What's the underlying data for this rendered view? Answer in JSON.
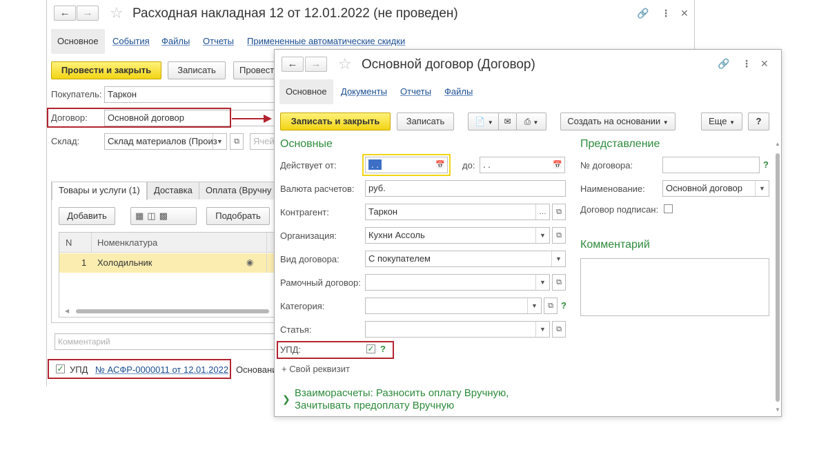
{
  "back": {
    "title": "Расходная накладная 12 от 12.01.2022 (не проведен)",
    "tabs": [
      "Основное",
      "События",
      "Файлы",
      "Отчеты",
      "Примененные автоматические скидки"
    ],
    "toolbar": {
      "post_close": "Провести и закрыть",
      "save": "Записать",
      "post": "Провест"
    },
    "buyer_label": "Покупатель:",
    "buyer_value": "Таркон",
    "contract_label": "Договор:",
    "contract_value": "Основной договор",
    "warehouse_label": "Склад:",
    "warehouse_value": "Склад материалов (Произ",
    "cell_placeholder": "Ячей",
    "inner_tabs": [
      "Товары и услуги (1)",
      "Доставка",
      "Оплата (Вручну"
    ],
    "table_toolbar": {
      "add": "Добавить",
      "pick": "Подобрать"
    },
    "table": {
      "headers": [
        "N",
        "Номенклатура"
      ],
      "rows": [
        {
          "n": "1",
          "item": "Холодильник"
        }
      ]
    },
    "comment_placeholder": "Комментарий",
    "upd_label": "УПД",
    "upd_link": "№ АСФР-0000011 от 12.01.2022",
    "basis_text": "Основани"
  },
  "front": {
    "title": "Основной договор (Договор)",
    "tabs": [
      "Основное",
      "Документы",
      "Отчеты",
      "Файлы"
    ],
    "toolbar": {
      "save_close": "Записать и закрыть",
      "save": "Записать",
      "create_basis": "Создать на основании",
      "more": "Еще",
      "help": "?"
    },
    "section_main": "Основные",
    "valid_from_label": "Действует от:",
    "valid_from_value": " .  .",
    "valid_to_label": "до:",
    "valid_to_value": " .  .",
    "currency_label": "Валюта расчетов:",
    "currency_value": "руб.",
    "counterparty_label": "Контрагент:",
    "counterparty_value": "Таркон",
    "organization_label": "Организация:",
    "organization_value": "Кухни Ассоль",
    "contract_type_label": "Вид договора:",
    "contract_type_value": "С покупателем",
    "frame_contract_label": "Рамочный договор:",
    "category_label": "Категория:",
    "article_label": "Статья:",
    "upd_label": "УПД:",
    "custom_attr": "+ Свой реквизит",
    "settlements_line1": "Взаиморасчеты: Разносить оплату Вручную,",
    "settlements_line2": "Зачитывать предоплату Вручную",
    "section_view": "Представление",
    "number_label": "№ договора:",
    "name_label": "Наименование:",
    "name_value": "Основной договор",
    "signed_label": "Договор подписан:",
    "section_comment": "Комментарий",
    "help_mark": "?"
  },
  "colors": {
    "highlight_red": "#b3232f",
    "section_green": "#2d8a3b",
    "primary_yellow": "#f2d414",
    "link_blue": "#1a4d91"
  }
}
